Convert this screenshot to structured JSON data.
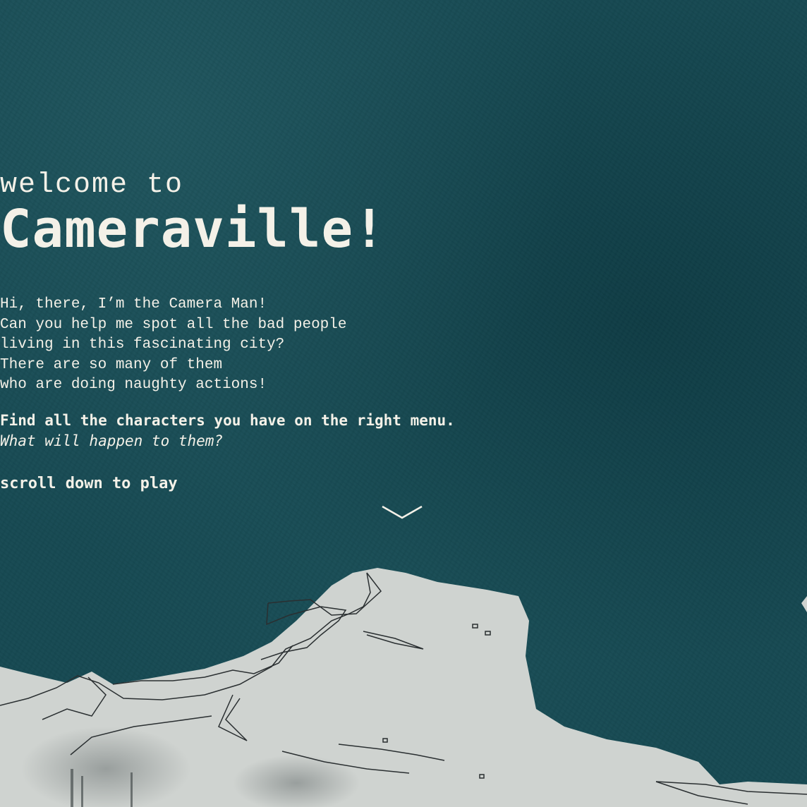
{
  "intro": {
    "welcome": "welcome to",
    "title": "Cameraville!",
    "body_lines": [
      "Hi, there, I’m the Camera Man!",
      "Can you help me spot all the bad people",
      "living in this fascinating city?",
      "There are so many of them",
      "who are doing naughty actions!"
    ],
    "find": "Find all the characters you have on the right menu.",
    "question": "What will happen to them?",
    "scroll": "scroll down to play",
    "scroll_icon": "chevron-down-icon"
  },
  "colors": {
    "background": "#174a53",
    "text": "#f4f1e8",
    "terrain": "#cfd3d0",
    "terrain_lines": "#2a2f31"
  }
}
